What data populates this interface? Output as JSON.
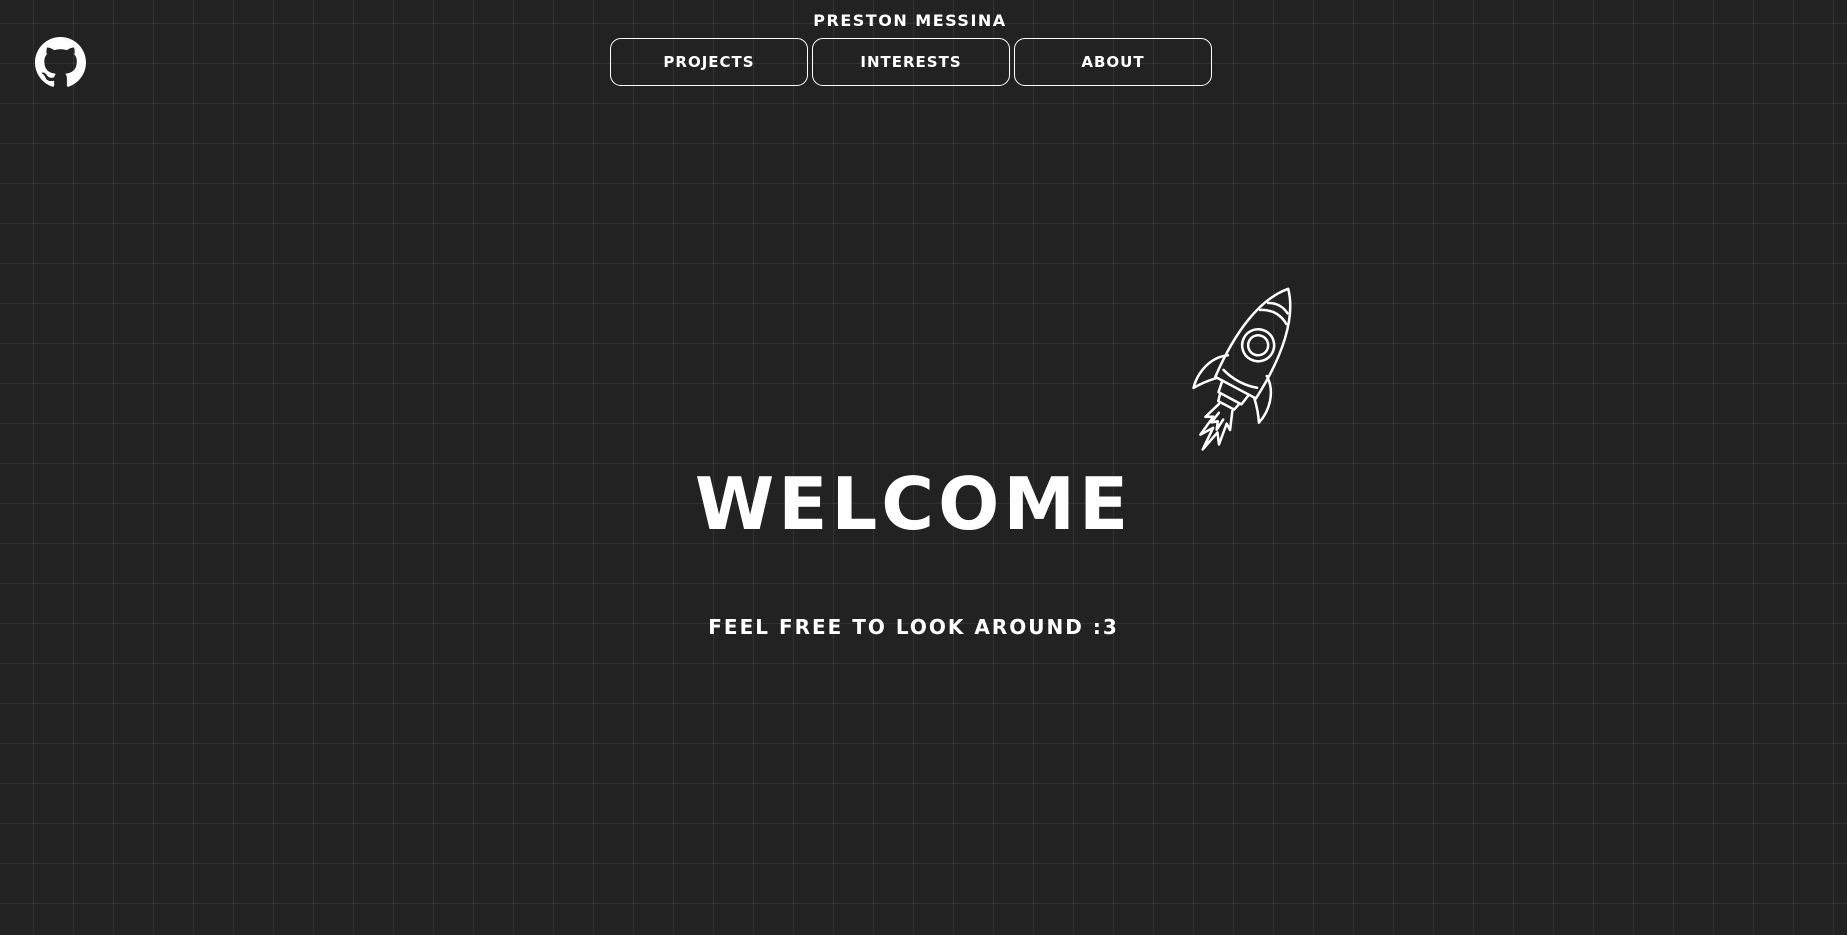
{
  "header": {
    "title": "Preston Messina",
    "github_icon": "github-icon"
  },
  "nav": {
    "items": [
      {
        "label": "Projects"
      },
      {
        "label": "Interests"
      },
      {
        "label": "About"
      }
    ]
  },
  "hero": {
    "title": "Welcome",
    "subtitle": "Feel free to look around :3",
    "illustration_icon": "rocket-icon"
  },
  "colors": {
    "background": "#222222",
    "grid": "#333333",
    "foreground": "#ffffff"
  }
}
